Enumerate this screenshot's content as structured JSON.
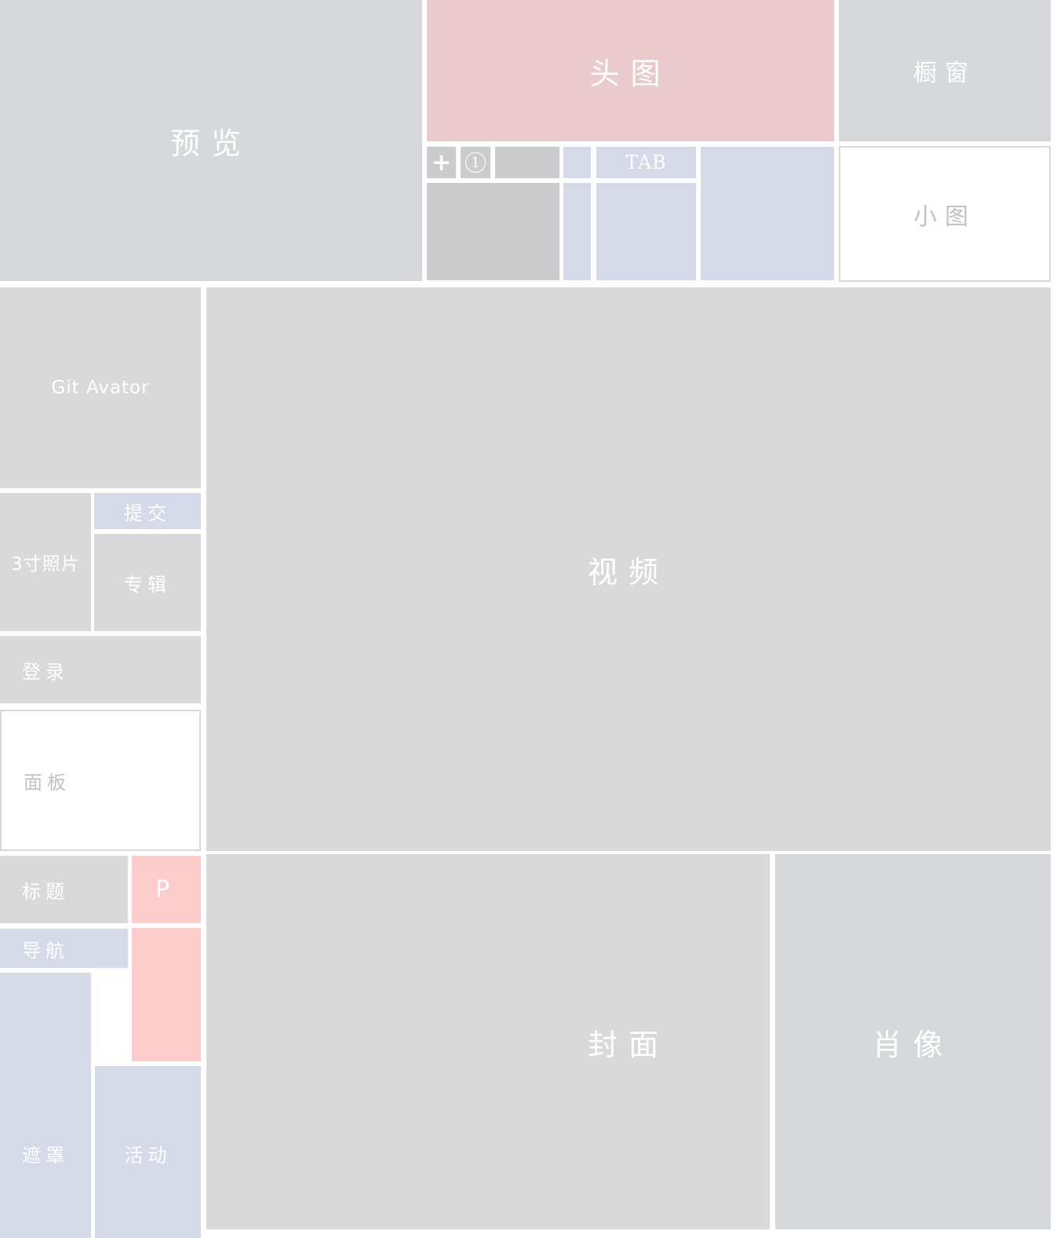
{
  "tiles": {
    "preview": "预览",
    "header_image": "头图",
    "showcase": "橱窗",
    "thumbnail": "小图",
    "tab": "TAB",
    "circle_one": "1",
    "git_avatar": "Git Avator",
    "submit": "提交",
    "photo_3inch": "3寸照片",
    "album": "专辑",
    "login": "登录",
    "panel": "面板",
    "video": "视频",
    "title": "标题",
    "p": "P",
    "nav": "导航",
    "mask": "遮罩",
    "activity": "活动",
    "cover": "封面",
    "portrait": "肖像"
  },
  "icons": {
    "plus": "plus-icon",
    "circled_number": "circled-number-one-icon"
  },
  "colors": {
    "gray": "#d7d8dc",
    "light_gray": "#d9d9d9",
    "dark_gray": "#cccccc",
    "lavender": "#d5d9e8",
    "rose": "#eacacd",
    "pink": "#ffcccc",
    "white": "#ffffff"
  }
}
